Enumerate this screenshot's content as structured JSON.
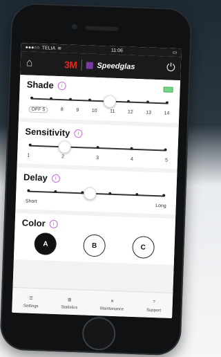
{
  "status": {
    "carrier": "TELIA",
    "time": "11:06"
  },
  "header": {
    "brand_mark": "3M",
    "brand_name": "Speedglas"
  },
  "shade": {
    "title": "Shade",
    "ticks": [
      "OFF 5",
      "8",
      "9",
      "10",
      "11",
      "12",
      "13",
      "14"
    ],
    "selected_index": 4
  },
  "sensitivity": {
    "title": "Sensitivity",
    "ticks": [
      "1",
      "2",
      "3",
      "4",
      "5"
    ],
    "selected_index": 1
  },
  "delay": {
    "title": "Delay",
    "min_label": "Short",
    "max_label": "Long",
    "level": 0.45
  },
  "color": {
    "title": "Color",
    "options": [
      "A",
      "B",
      "C"
    ],
    "selected": "A"
  },
  "tabs": [
    {
      "label": "Settings",
      "icon": "sliders-icon"
    },
    {
      "label": "Statistics",
      "icon": "bar-chart-icon"
    },
    {
      "label": "Maintenance",
      "icon": "tools-icon"
    },
    {
      "label": "Support",
      "icon": "help-icon"
    }
  ]
}
